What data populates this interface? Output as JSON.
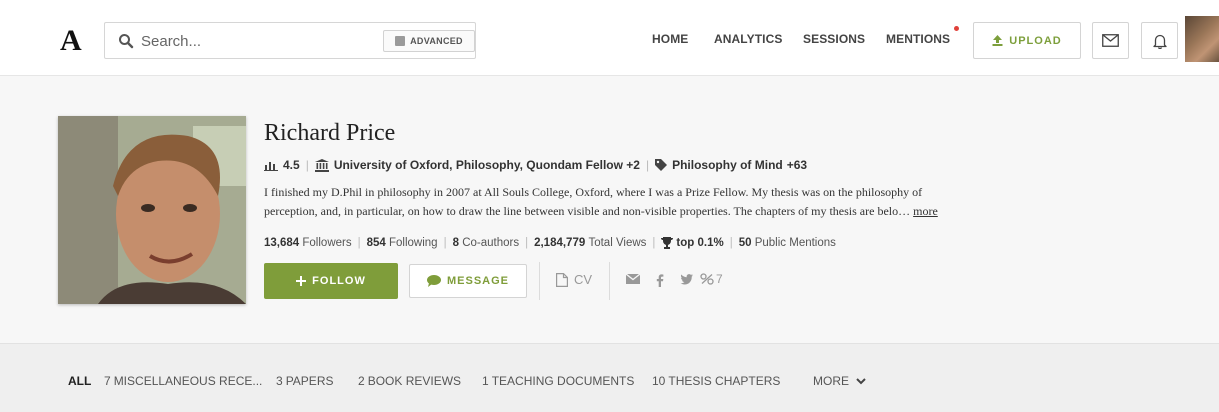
{
  "header": {
    "logo": "A",
    "search_placeholder": "Search...",
    "advanced_label": "ADVANCED",
    "nav": [
      "HOME",
      "ANALYTICS",
      "SESSIONS",
      "MENTIONS"
    ],
    "upload_label": "UPLOAD"
  },
  "profile": {
    "name": "Richard Price",
    "score": "4.5",
    "affiliation": "University of Oxford, Philosophy, Quondam Fellow +2",
    "topic": "Philosophy of Mind",
    "topic_more": "+63",
    "bio_line1": "I finished my D.Phil in philosophy in 2007 at All Souls College, Oxford, where I was a Prize Fellow. My thesis was on the philosophy of",
    "bio_line2": "perception, and, in particular, on how to draw the line between visible and non-visible properties. The chapters of my thesis are belo…",
    "bio_more": "more",
    "stats": {
      "followers_count": "13,684",
      "followers_label": "Followers",
      "following_count": "854",
      "following_label": "Following",
      "coauthors_count": "8",
      "coauthors_label": "Co-authors",
      "views_count": "2,184,779",
      "views_label": "Total Views",
      "top_value": "top 0.1%",
      "mentions_count": "50",
      "mentions_label": "Public Mentions"
    },
    "follow_label": "FOLLOW",
    "message_label": "MESSAGE",
    "cv_label": "CV",
    "links_count": "7"
  },
  "tabs": [
    {
      "count": "",
      "label": "ALL"
    },
    {
      "count": "7",
      "label": "MISCELLANEOUS RECE..."
    },
    {
      "count": "3",
      "label": "PAPERS"
    },
    {
      "count": "2",
      "label": "BOOK REVIEWS"
    },
    {
      "count": "1",
      "label": "TEACHING DOCUMENTS"
    },
    {
      "count": "10",
      "label": "THESIS CHAPTERS"
    },
    {
      "count": "",
      "label": "MORE"
    }
  ],
  "colors": {
    "accent": "#7f9d3a",
    "notification": "#e0413a"
  }
}
